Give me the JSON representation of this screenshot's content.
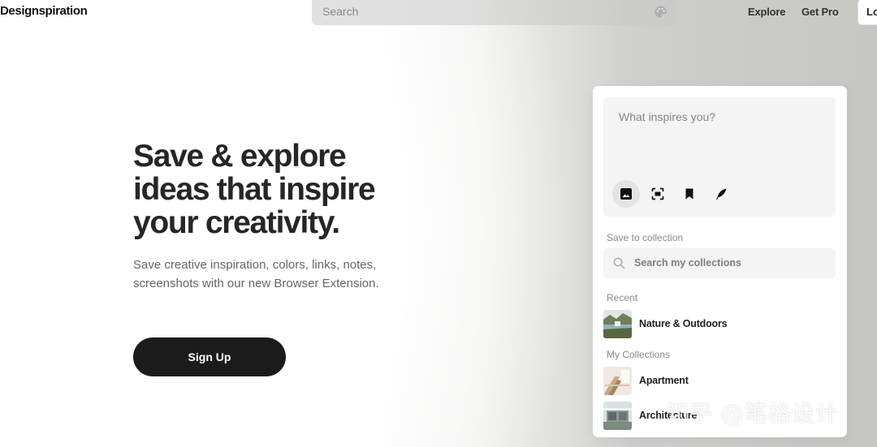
{
  "header": {
    "logo": "Designspiration",
    "search_placeholder": "Search",
    "nav": [
      "Explore",
      "Get Pro"
    ],
    "login_label": "Lo"
  },
  "hero": {
    "title_lines": [
      "Save & explore",
      "ideas that inspire",
      "your creativity."
    ],
    "subtitle_lines": [
      "Save creative inspiration, colors, links, notes,",
      "screenshots with our new Browser Extension."
    ],
    "signup_label": "Sign Up"
  },
  "extension": {
    "composer_placeholder": "What inspires you?",
    "tools": [
      "image-icon",
      "screenshot-icon",
      "bookmark-icon",
      "feather-icon"
    ],
    "save_to_collection_label": "Save to collection",
    "collection_search_placeholder": "Search my collections",
    "recent_label": "Recent",
    "recent": [
      {
        "name": "Nature & Outdoors"
      }
    ],
    "my_collections_label": "My Collections",
    "collections": [
      {
        "name": "Apartment"
      },
      {
        "name": "Architecture"
      }
    ]
  },
  "watermark": "知乎 @笔格设计"
}
